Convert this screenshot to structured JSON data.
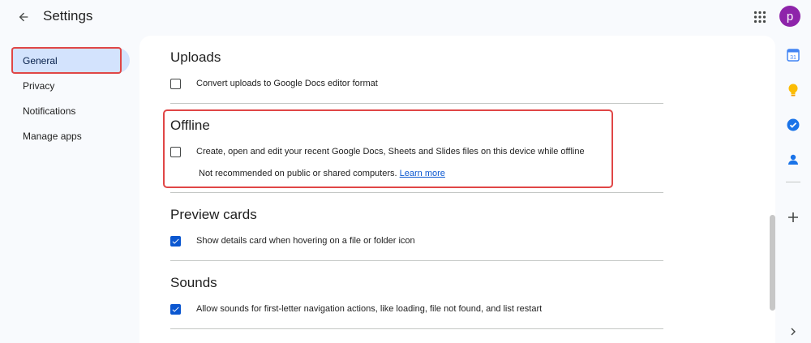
{
  "header": {
    "title": "Settings",
    "avatar_letter": "p",
    "back_icon": "arrow-back-icon",
    "apps_icon": "apps-grid-icon"
  },
  "sidebar": {
    "items": [
      {
        "label": "General",
        "active": true
      },
      {
        "label": "Privacy",
        "active": false
      },
      {
        "label": "Notifications",
        "active": false
      },
      {
        "label": "Manage apps",
        "active": false
      }
    ]
  },
  "sections": {
    "uploads": {
      "title": "Uploads",
      "option": {
        "label": "Convert uploads to Google Docs editor format",
        "checked": false
      }
    },
    "offline": {
      "title": "Offline",
      "option": {
        "label": "Create, open and edit your recent Google Docs, Sheets and Slides files on this device while offline",
        "checked": false
      },
      "note": "Not recommended on public or shared computers.",
      "link": "Learn more"
    },
    "preview_cards": {
      "title": "Preview cards",
      "option": {
        "label": "Show details card when hovering on a file or folder icon",
        "checked": true
      }
    },
    "sounds": {
      "title": "Sounds",
      "option": {
        "label": "Allow sounds for first-letter navigation actions, like loading, file not found, and list restart",
        "checked": true
      }
    }
  },
  "side_panel": {
    "icons": [
      "calendar-icon",
      "keep-icon",
      "tasks-icon",
      "contacts-icon",
      "add-icon"
    ],
    "calendar_day": "31",
    "expand_icon": "chevron-right-icon"
  },
  "colors": {
    "accent": "#0b57d0",
    "active_nav_bg": "#d3e3fd",
    "highlight_border": "#e04646",
    "avatar_bg": "#8e24aa",
    "page_bg": "#f8fafd"
  }
}
